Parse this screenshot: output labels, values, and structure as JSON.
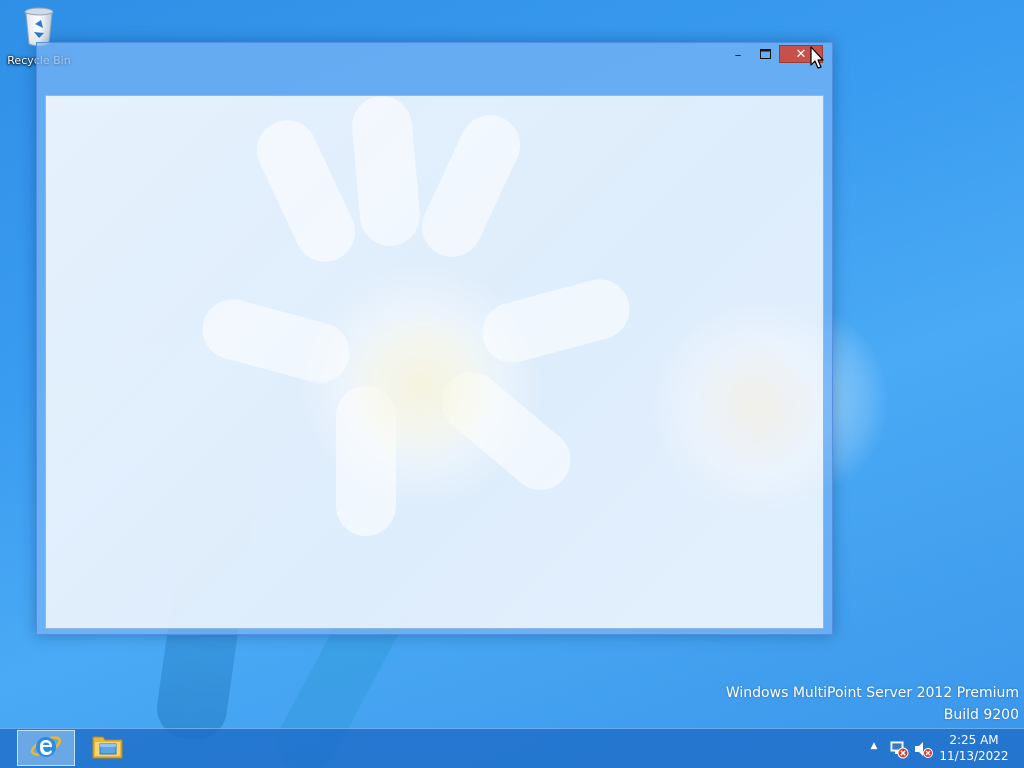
{
  "desktop": {
    "icons": [
      {
        "label": "Recycle Bin",
        "icon": "recycle-bin-icon"
      }
    ]
  },
  "window": {
    "title": "",
    "controls": {
      "minimize": "–",
      "maximize": "☐",
      "close": "✕"
    },
    "close_color": "#c7504a"
  },
  "watermark": {
    "line1": "Windows MultiPoint Server 2012 Premium",
    "line2": "Build 9200"
  },
  "taskbar": {
    "pinned": [
      {
        "name": "Internet Explorer",
        "icon": "internet-explorer-icon",
        "active": true
      },
      {
        "name": "File Explorer",
        "icon": "file-explorer-icon",
        "active": false
      }
    ],
    "tray": {
      "show_hidden_icons": "▲",
      "network_icon": "network-disconnected-icon",
      "volume_icon": "volume-muted-icon"
    },
    "clock": {
      "time": "2:25 AM",
      "date": "11/13/2022"
    }
  },
  "colors": {
    "desktop_background": "#3a9cf0",
    "taskbar": "#1e6ec8",
    "window_frame": "#78b4f5",
    "close_button": "#c7504a"
  }
}
